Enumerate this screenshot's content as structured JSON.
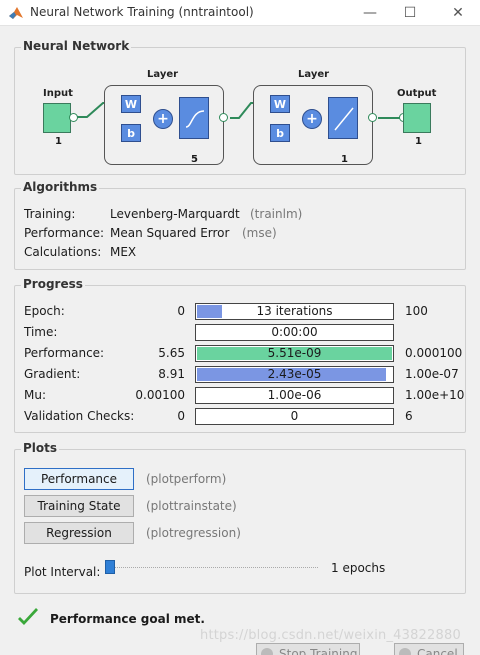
{
  "window": {
    "title": "Neural Network Training (nntraintool)",
    "minimize": "—",
    "maximize": "☐",
    "close": "✕"
  },
  "network": {
    "panel_title": "Neural Network",
    "input_label": "Input",
    "input_size": "1",
    "layers": [
      {
        "title": "Layer",
        "w": "W",
        "b": "b",
        "size": "5",
        "activation": "tansig"
      },
      {
        "title": "Layer",
        "w": "W",
        "b": "b",
        "size": "1",
        "activation": "purelin"
      }
    ],
    "output_label": "Output",
    "output_size": "1",
    "colors": {
      "io_box": "#6ad39f",
      "layer_block": "#5a8ce0",
      "wire": "#2f8a5a"
    }
  },
  "algorithms": {
    "panel_title": "Algorithms",
    "rows": [
      {
        "label": "Training:",
        "value": "Levenberg-Marquardt",
        "fn": "(trainlm)"
      },
      {
        "label": "Performance:",
        "value": "Mean Squared Error",
        "fn": "(mse)"
      },
      {
        "label": "Calculations:",
        "value": "MEX",
        "fn": ""
      }
    ]
  },
  "progress": {
    "panel_title": "Progress",
    "rows": [
      {
        "label": "Epoch:",
        "start": "0",
        "current": "13 iterations",
        "end": "100",
        "fraction": 0.13,
        "color": "#7b96e3"
      },
      {
        "label": "Time:",
        "start": "",
        "current": "0:00:00",
        "end": "",
        "fraction": 0,
        "color": "#ffffff"
      },
      {
        "label": "Performance:",
        "start": "5.65",
        "current": "5.51e-09",
        "end": "0.000100",
        "fraction": 1.0,
        "color": "#6ad39f"
      },
      {
        "label": "Gradient:",
        "start": "8.91",
        "current": "2.43e-05",
        "end": "1.00e-07",
        "fraction": 0.97,
        "color": "#7b96e3"
      },
      {
        "label": "Mu:",
        "start": "0.00100",
        "current": "1.00e-06",
        "end": "1.00e+10",
        "fraction": 0,
        "color": "#7b96e3"
      },
      {
        "label": "Validation Checks:",
        "start": "0",
        "current": "0",
        "end": "6",
        "fraction": 0,
        "color": "#7b96e3"
      }
    ]
  },
  "plots": {
    "panel_title": "Plots",
    "buttons": [
      {
        "label": "Performance",
        "fn": "(plotperform)"
      },
      {
        "label": "Training State",
        "fn": "(plottrainstate)"
      },
      {
        "label": "Regression",
        "fn": "(plotregression)"
      }
    ],
    "interval_label": "Plot Interval:",
    "interval_value": "1 epochs"
  },
  "status": {
    "message": "Performance goal met.",
    "icon": "check-icon",
    "color": "#3aa83a"
  },
  "watermark": "https://blog.csdn.net/weixin_43822880",
  "footer": {
    "stop_label": "Stop Training",
    "cancel_label": "Cancel"
  }
}
